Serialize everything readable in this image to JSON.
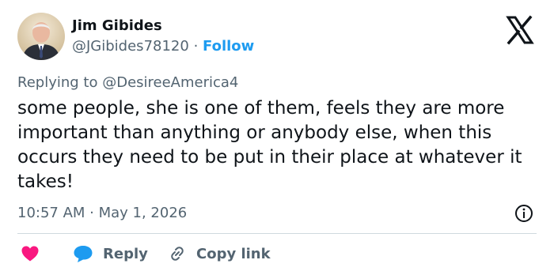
{
  "author": {
    "name": "Jim Gibides",
    "handle": "@JGibides78120",
    "separator": "·",
    "follow_label": "Follow"
  },
  "platform_icon": "x-logo-icon",
  "replying": {
    "prefix": "Replying to",
    "mention": "@DesireeAmerica4"
  },
  "tweet": {
    "text": "some people, she is one of them, feels they are more important than anything or anybody else, when this occurs they need to be put in their place at whatever it takes!",
    "timestamp": "10:57 AM · May 1, 2026"
  },
  "actions": {
    "like_icon": "heart-icon",
    "reply_label": "Reply",
    "copy_label": "Copy link"
  },
  "colors": {
    "accent": "#1d9bf0",
    "like": "#f91880",
    "secondary_text": "#536471",
    "primary_text": "#0f1419",
    "divider": "#cfd9de"
  }
}
